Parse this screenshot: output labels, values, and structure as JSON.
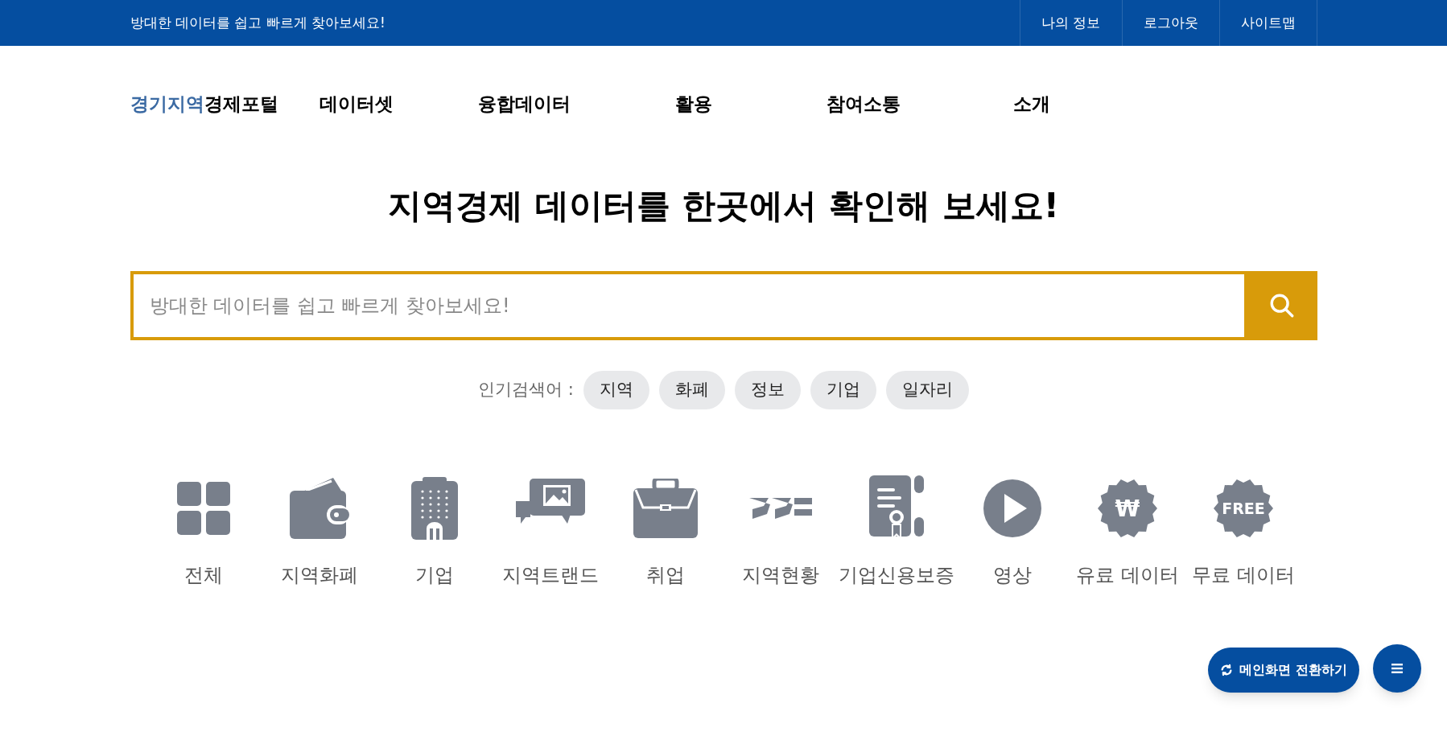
{
  "top_bar": {
    "slogan": "방대한 데이터를 쉽고 빠르게 찾아보세요!",
    "links": [
      "나의 정보",
      "로그아웃",
      "사이트맵"
    ]
  },
  "header": {
    "logo": {
      "accent": "경기지역",
      "rest": "경제포털"
    },
    "nav": [
      "데이터셋",
      "융합데이터",
      "활용",
      "참여소통",
      "소개"
    ]
  },
  "hero": {
    "headline": "지역경제 데이터를 한곳에서 확인해 보세요!"
  },
  "search": {
    "placeholder": "방대한 데이터를 쉽고 빠르게 찾아보세요!"
  },
  "popular": {
    "label": "인기검색어 :",
    "keywords": [
      "지역",
      "화폐",
      "정보",
      "기업",
      "일자리"
    ]
  },
  "categories": [
    {
      "kind": "grid",
      "label": "전체"
    },
    {
      "kind": "wallet",
      "label": "지역화폐"
    },
    {
      "kind": "building",
      "label": "기업"
    },
    {
      "kind": "chat",
      "label": "지역트랜드"
    },
    {
      "kind": "briefcase",
      "label": "취업"
    },
    {
      "kind": "logo",
      "label": "지역현황"
    },
    {
      "kind": "certificate",
      "label": "기업신용보증"
    },
    {
      "kind": "play",
      "label": "영상"
    },
    {
      "kind": "badge",
      "label": "유료 데이터",
      "icon_text": "₩"
    },
    {
      "kind": "badge",
      "label": "무료 데이터",
      "icon_text": "FREE"
    }
  ],
  "floating": {
    "switch_button": "메인화면 전환하기"
  }
}
